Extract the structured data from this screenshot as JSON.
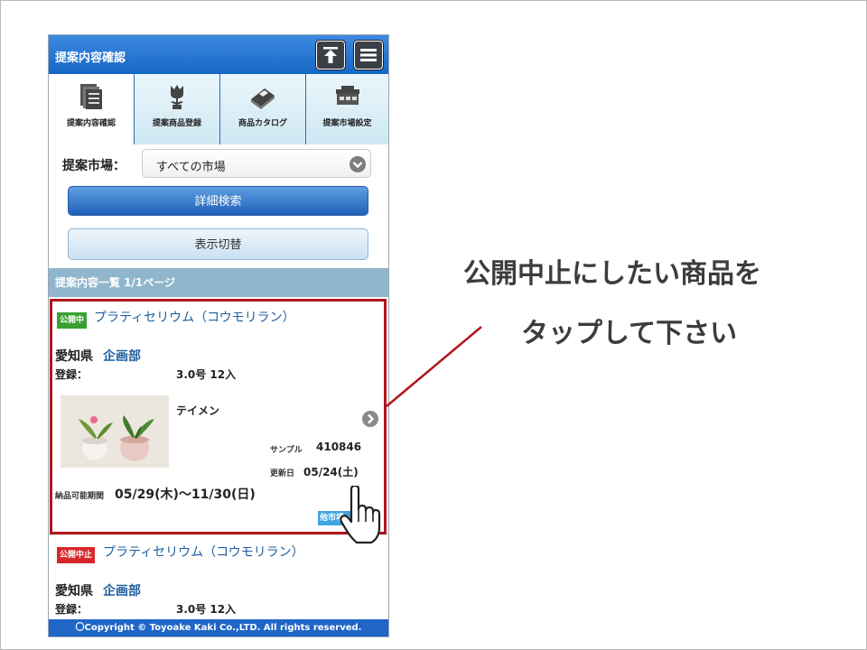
{
  "header": {
    "title": "提案内容確認",
    "upload_icon": "upload-top-icon",
    "menu_icon": "menu-icon"
  },
  "tabs": [
    {
      "label": "提案内容確認",
      "icon": "document-stack-icon",
      "active": true
    },
    {
      "label": "提案商品登録",
      "icon": "tulip-icon",
      "active": false
    },
    {
      "label": "商品カタログ",
      "icon": "catalog-book-icon",
      "active": false
    },
    {
      "label": "提案市場設定",
      "icon": "market-building-icon",
      "active": false
    }
  ],
  "filter": {
    "market_label": "提案市場：",
    "market_value": "すべての市場"
  },
  "buttons": {
    "detail_search": "詳細検索",
    "toggle_view": "表示切替"
  },
  "list": {
    "header": "提案内容一覧 1/1ページ",
    "items": [
      {
        "status": "公開中",
        "name": "プラティセリウム（コウモリラン）",
        "prefecture": "愛知県",
        "department": "企画部",
        "reg_label": "登録：",
        "spec": "3.0号 12入",
        "variety": "テイメン",
        "sample_label": "サンプル",
        "sample_value": "410846",
        "updated_label": "更新日",
        "updated_value": "05/24(土)",
        "period_label": "納品可能期間",
        "period_value": "05/29(木)〜11/30(日)",
        "other_badge": "他市場"
      },
      {
        "status": "公開中止",
        "name": "プラティセリウム（コウモリラン）",
        "prefecture": "愛知県",
        "department": "企画部",
        "reg_label": "登録：",
        "spec": "3.0号 12入"
      }
    ]
  },
  "footer": "〇Copyright © Toyoake Kaki Co.,LTD. All rights reserved.",
  "instruction": {
    "line1": "公開中止にしたい商品を",
    "line2": "タップして下さい"
  },
  "colors": {
    "header_blue": "#1666c6",
    "highlight_red": "#b0161c",
    "status_green": "#3aa030",
    "status_red": "#d9262b"
  }
}
